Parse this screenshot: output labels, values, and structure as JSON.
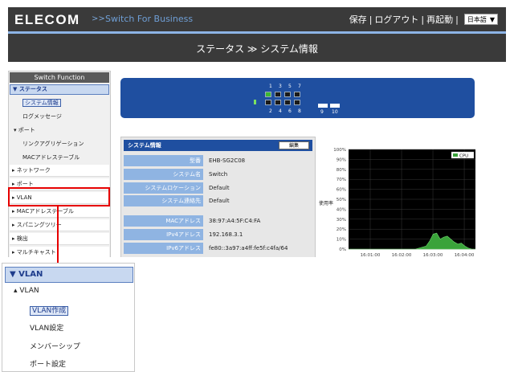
{
  "header": {
    "logo": "ELECOM",
    "separator": ">>",
    "subtitle": "Switch For Business",
    "menu": [
      "保存",
      "ログアウト",
      "再起動"
    ],
    "language": "日本語"
  },
  "page_title": "ステータス ≫ システム情報",
  "sidebar": {
    "title": "Switch Function",
    "selected_section": "▼ ステータス",
    "status_items": [
      "システム情報",
      "ログメッセージ"
    ],
    "port_group": "▾ ポート",
    "port_subitems": [
      "リンクアグリゲーション",
      "MACアドレステーブル"
    ],
    "items": [
      "ネットワーク",
      "ポート",
      "VLAN",
      "MACアドレステーブル",
      "スパニングツリー",
      "検出",
      "マルチキャスト"
    ]
  },
  "switch_panel": {
    "top_numbers": [
      "1",
      "3",
      "5",
      "7"
    ],
    "bottom_numbers": [
      "2",
      "4",
      "6",
      "8"
    ],
    "uplink_numbers": [
      "9",
      "10"
    ]
  },
  "system_info": {
    "title": "システム情報",
    "edit_button": "編集",
    "rows": [
      {
        "label": "型番",
        "value": "EHB-SG2C08"
      },
      {
        "label": "システム名",
        "value": "Switch"
      },
      {
        "label": "システムロケーション",
        "value": "Default"
      },
      {
        "label": "システム連絡先",
        "value": "Default"
      },
      {
        "label": "MACアドレス",
        "value": "38:97:A4:5F:C4:FA"
      },
      {
        "label": "IPv4アドレス",
        "value": "192.168.3.1"
      },
      {
        "label": "IPv6アドレス",
        "value": "fe80::3a97:a4ff:fe5f:c4fa/64"
      }
    ]
  },
  "cpu_chart": {
    "type": "area",
    "ylabel": "使用率",
    "legend": "CPU",
    "y_ticks": [
      "100%",
      "90%",
      "80%",
      "70%",
      "60%",
      "50%",
      "40%",
      "30%",
      "20%",
      "10%",
      "0%"
    ],
    "x_ticks": [
      "16:01:00",
      "16:02:00",
      "16:03:00",
      "16:04:00"
    ],
    "ylim": [
      0,
      100
    ],
    "series": [
      {
        "name": "CPU",
        "values": [
          0,
          0,
          0,
          0,
          0,
          0,
          0,
          0,
          0,
          0,
          0,
          0,
          0,
          0,
          0,
          0,
          0,
          0,
          0,
          0,
          1,
          2,
          3,
          8,
          15,
          16,
          10,
          12,
          13,
          10,
          7,
          5,
          6,
          3,
          1,
          0,
          0
        ]
      }
    ]
  },
  "zoom_menu": {
    "header": "▼ VLAN",
    "section": "▴ VLAN",
    "items": [
      "VLAN作成",
      "VLAN設定",
      "メンバーシップ",
      "ポート設定"
    ]
  },
  "colors": {
    "header_bg": "#3a3a3a",
    "accent_blue": "#1f4fa0",
    "label_blue": "#8fb4e2",
    "highlight": "#e60000",
    "cpu_fill": "#3aa33a"
  }
}
